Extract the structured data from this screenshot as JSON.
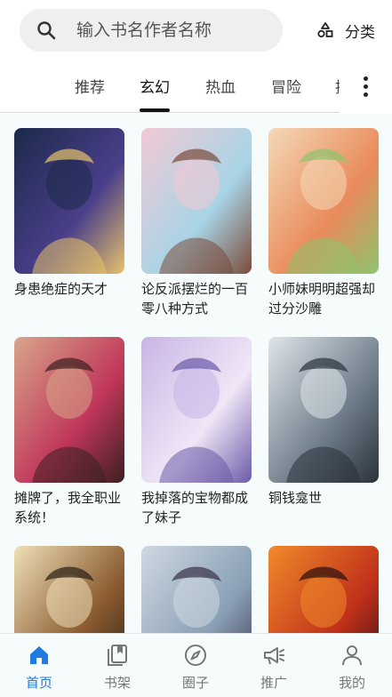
{
  "search": {
    "placeholder": "输入书名作者名称"
  },
  "category": {
    "label": "分类",
    "icon": "category-shapes-icon"
  },
  "tabs": [
    {
      "label": "推荐",
      "active": false
    },
    {
      "label": "玄幻",
      "active": true
    },
    {
      "label": "热血",
      "active": false
    },
    {
      "label": "冒险",
      "active": false
    },
    {
      "label": "搞",
      "active": false
    }
  ],
  "books": [
    {
      "title": "身患绝症的天才",
      "cover_colors": [
        "#1b2a4a",
        "#4a3f8a",
        "#e8c26a"
      ]
    },
    {
      "title": "论反派摆烂的一百零八种方式",
      "cover_colors": [
        "#f2c9d5",
        "#a8d4e6",
        "#7a4b3a"
      ]
    },
    {
      "title": "小师妹明明超强却过分沙雕",
      "cover_colors": [
        "#f4d9b8",
        "#e98a5a",
        "#8dc46e"
      ]
    },
    {
      "title": "摊牌了，我全职业系统！",
      "cover_colors": [
        "#d8a58a",
        "#c0365a",
        "#3a2020"
      ]
    },
    {
      "title": "我掉落的宝物都成了妹子",
      "cover_colors": [
        "#c9b5e6",
        "#f0e6f6",
        "#6a5aa8"
      ]
    },
    {
      "title": "铜钱龛世",
      "cover_colors": [
        "#dfe5ea",
        "#6f7d8a",
        "#2a323a"
      ]
    },
    {
      "title": "",
      "cover_colors": [
        "#efe0b8",
        "#8a5a30",
        "#2a2016"
      ]
    },
    {
      "title": "",
      "cover_colors": [
        "#cfd8e2",
        "#8aa0b6",
        "#3a3046"
      ]
    },
    {
      "title": "",
      "cover_colors": [
        "#f08a2a",
        "#c0301a",
        "#2a1010"
      ]
    }
  ],
  "bottom_nav": [
    {
      "label": "首页",
      "icon": "home-icon",
      "active": true
    },
    {
      "label": "书架",
      "icon": "bookshelf-icon",
      "active": false
    },
    {
      "label": "圈子",
      "icon": "compass-icon",
      "active": false
    },
    {
      "label": "推广",
      "icon": "megaphone-icon",
      "active": false
    },
    {
      "label": "我的",
      "icon": "profile-icon",
      "active": false
    }
  ],
  "colors": {
    "accent": "#1e7be0",
    "background": "#f6fbfb",
    "search_bg": "#efefef"
  }
}
